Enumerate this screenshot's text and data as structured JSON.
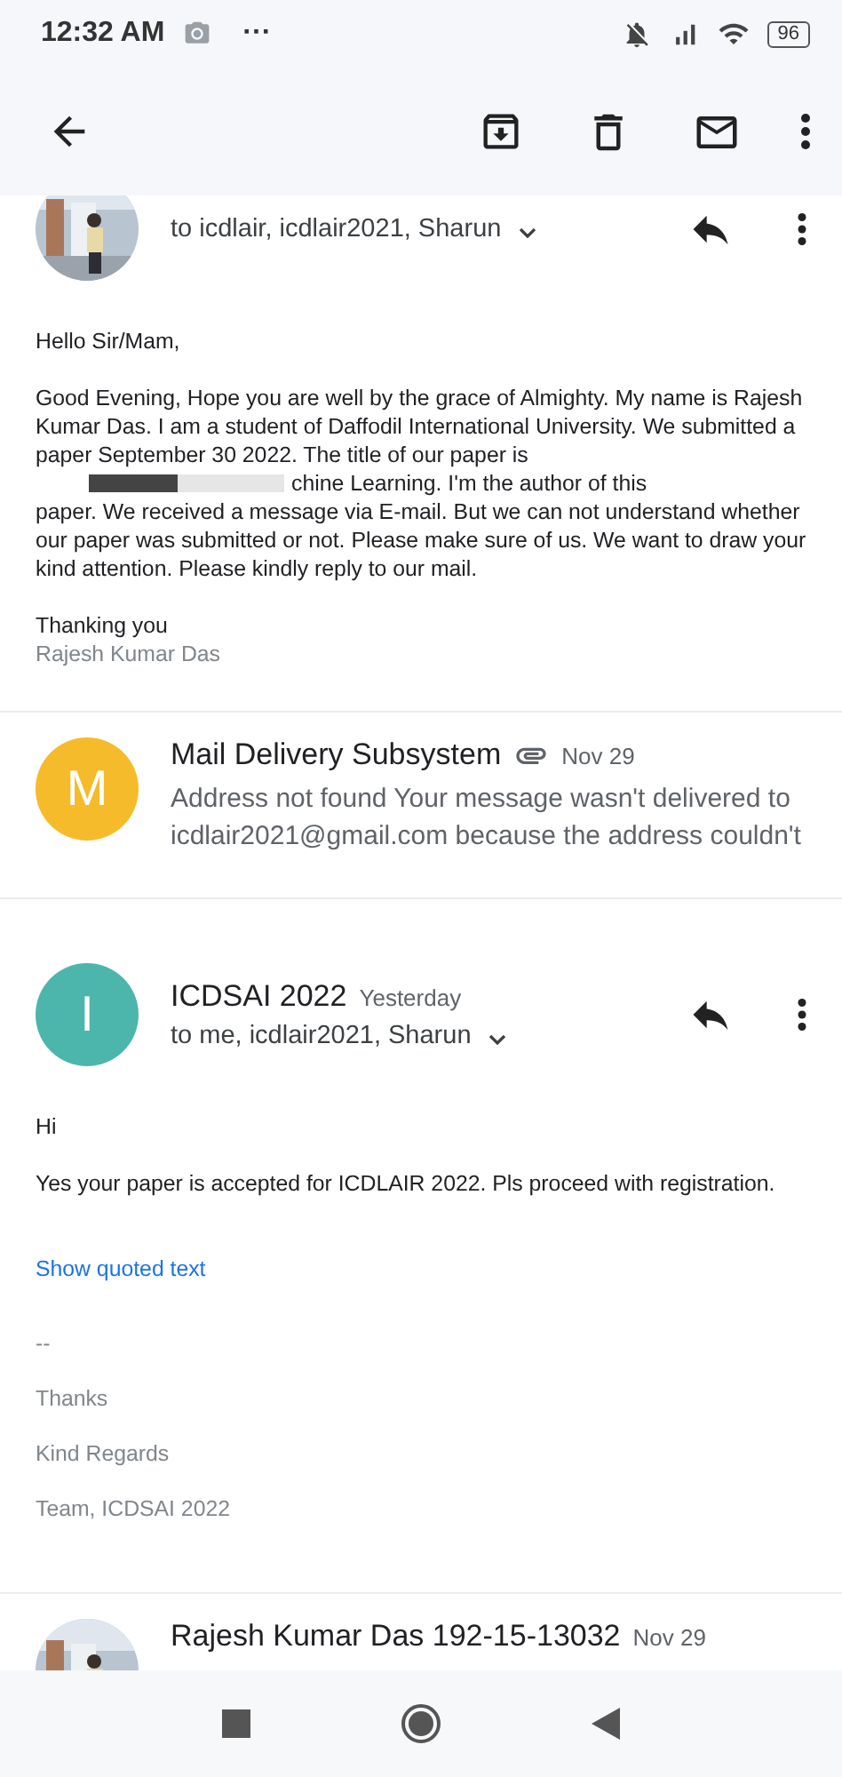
{
  "status_bar": {
    "time": "12:32 AM",
    "more": "···",
    "battery": "96"
  },
  "messages": [
    {
      "kind": "expanded",
      "recipients": "to icdlair, icdlair2021, Sharun",
      "body": [
        {
          "kind": "para",
          "text": "Hello Sir/Mam,"
        },
        {
          "kind": "redacted",
          "before": "Good Evening, Hope you are well by the grace of Almighty. My name is Rajesh Kumar Das. I am a student of Daffodil International University. We submitted a paper September 30 2022. The title of our paper is",
          "after": "chine Learning. I'm the author of this",
          "rest": "paper. We received a message via E-mail. But we can not understand whether our paper was submitted or not. Please make sure of us. We want to draw your kind attention. Please kindly reply to our mail."
        },
        {
          "kind": "para",
          "text": "Thanking you"
        },
        {
          "kind": "signature",
          "text": "Rajesh Kumar Das"
        }
      ]
    },
    {
      "kind": "collapsed",
      "avatar": {
        "kind": "letter",
        "letter": "M",
        "color": "#f6bb2a"
      },
      "sender": "Mail Delivery Subsystem",
      "attachment": true,
      "date": "Nov 29",
      "snippet": "Address not found Your message wasn't delivered to icdlair2021@gmail.com because the address couldn't"
    },
    {
      "kind": "expanded",
      "avatar": {
        "kind": "letter",
        "letter": "I",
        "color": "#4db6ac"
      },
      "sender": "ICDSAI 2022",
      "date": "Yesterday",
      "recipients": "to me, icdlair2021, Sharun",
      "body": [
        {
          "kind": "para",
          "text": "Hi"
        },
        {
          "kind": "para",
          "text": "Yes your paper is accepted for ICDLAIR 2022. Pls proceed with registration."
        },
        {
          "kind": "link",
          "text": "Show quoted text"
        },
        {
          "kind": "muted",
          "text": "--"
        },
        {
          "kind": "muted",
          "text": "Thanks"
        },
        {
          "kind": "muted",
          "text": "Kind Regards"
        },
        {
          "kind": "muted",
          "text": "Team, ICDSAI 2022"
        }
      ]
    },
    {
      "kind": "collapsed",
      "sender": "Rajesh Kumar Das 192-15-13032",
      "attachment": false,
      "date": "Nov 29"
    }
  ]
}
